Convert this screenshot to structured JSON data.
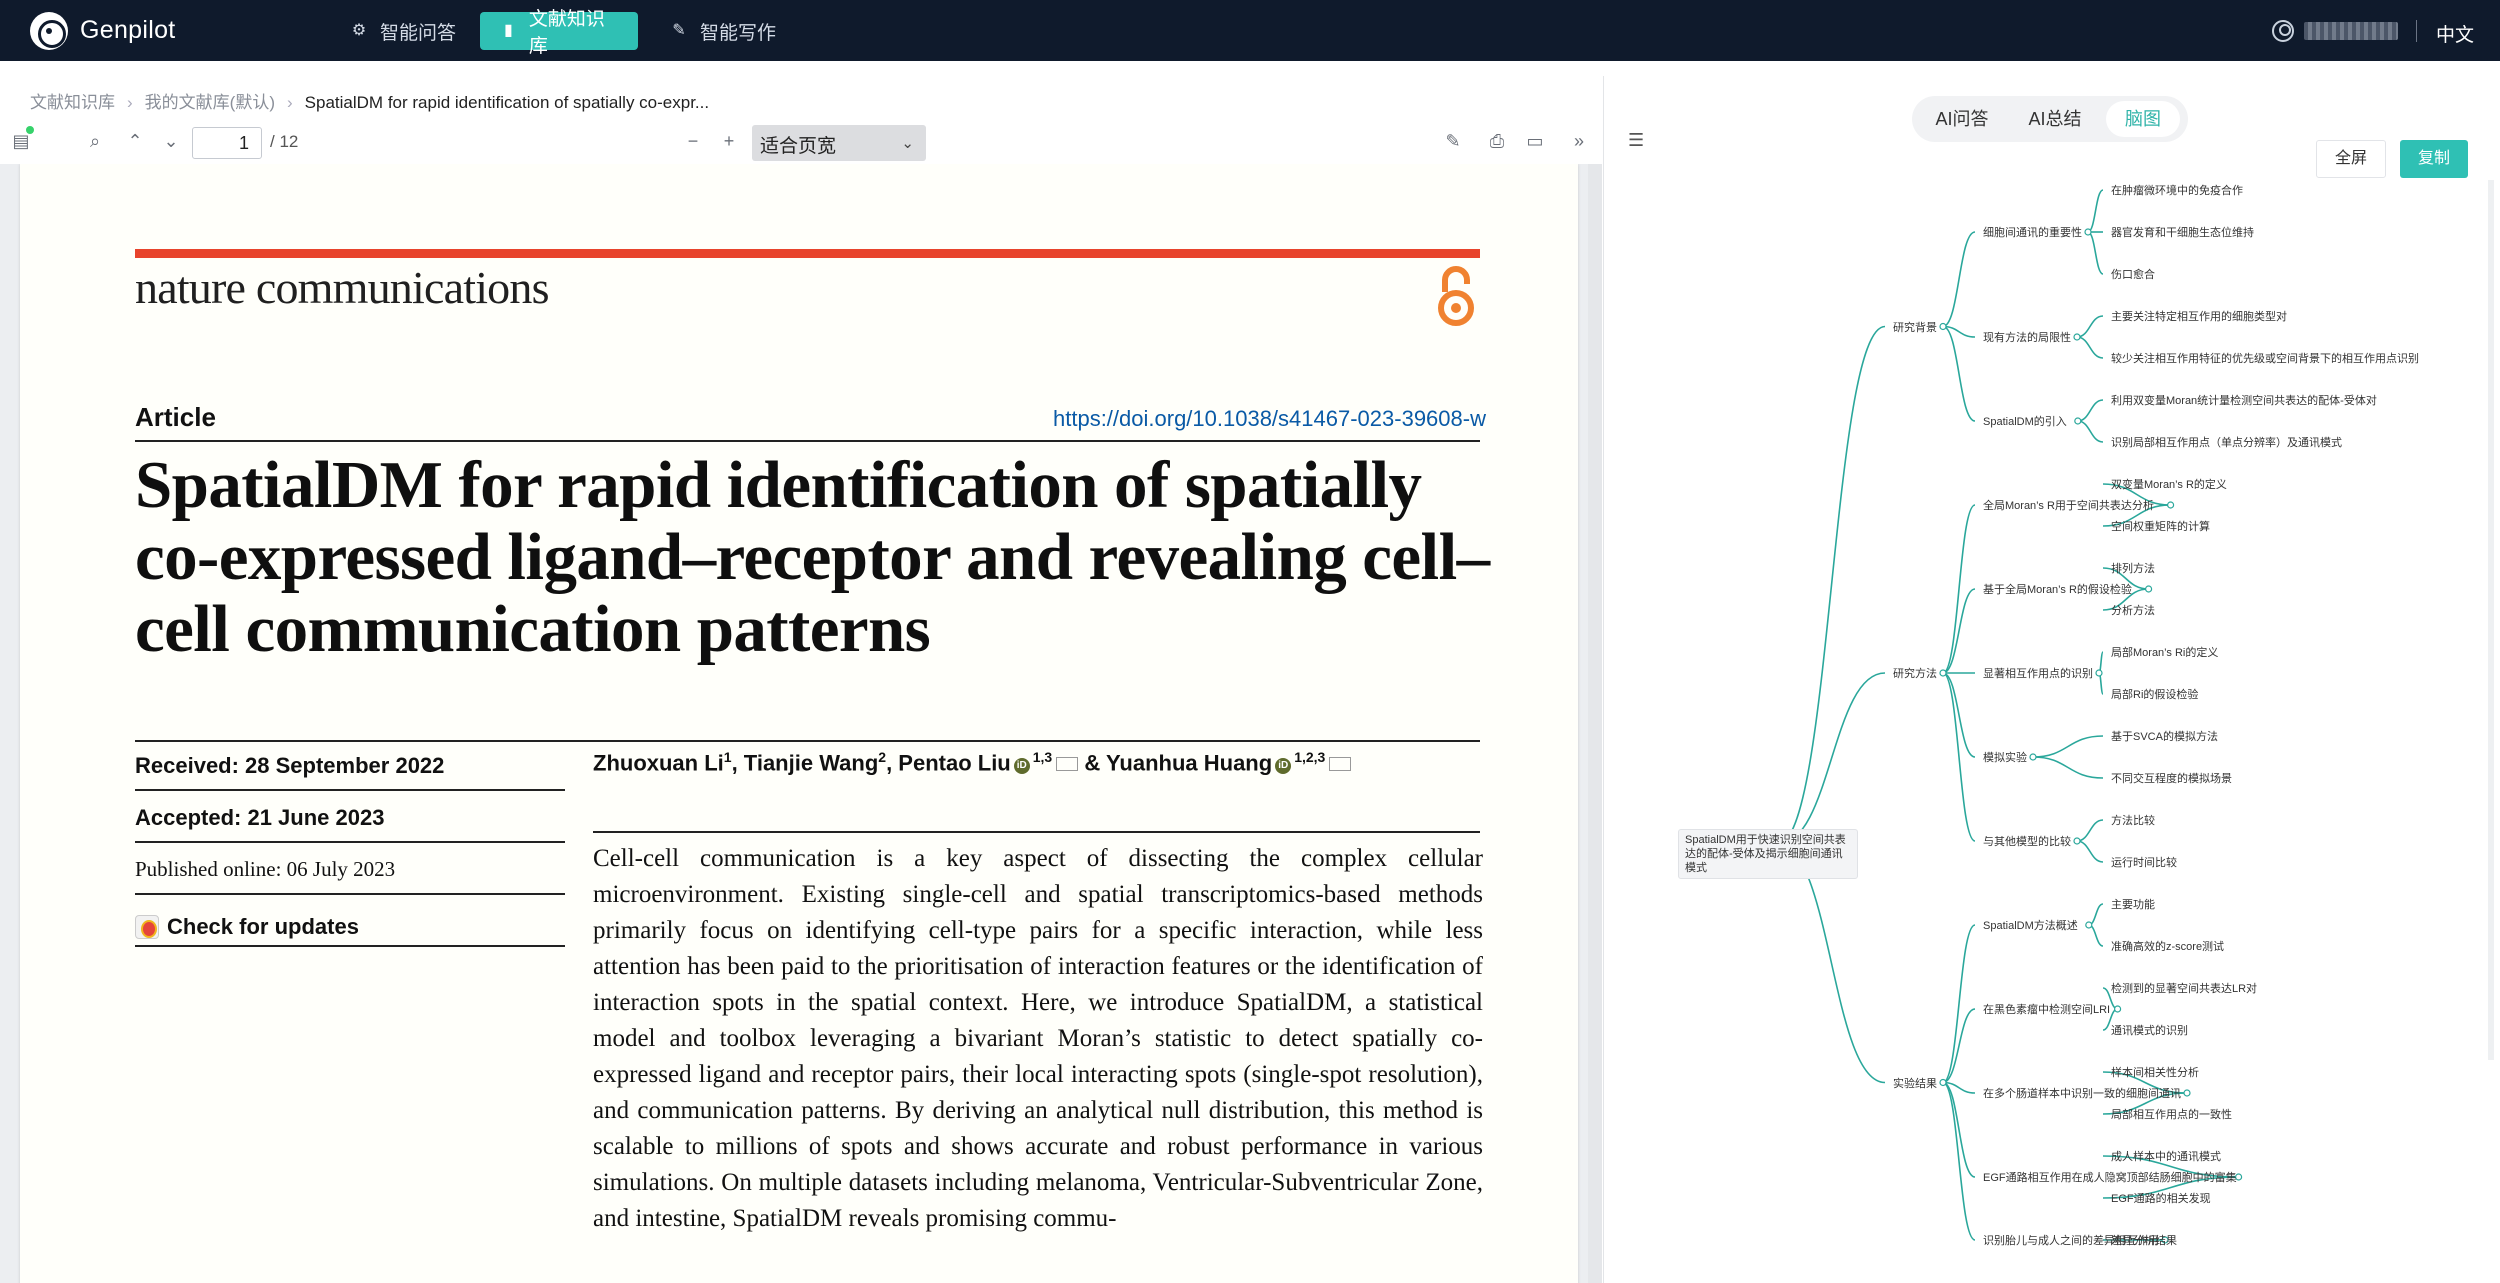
{
  "app": {
    "brand": "Genpilot",
    "nav_tabs": [
      {
        "label": "智能问答",
        "icon": "gear-icon"
      },
      {
        "label": "文献知识库",
        "icon": "book-icon"
      },
      {
        "label": "智能写作",
        "icon": "edit-icon"
      }
    ],
    "active_tab": "文献知识库",
    "language": "中文"
  },
  "breadcrumb": [
    "文献知识库",
    "我的文献库(默认)",
    "SpatialDM for rapid identification of spatially co-expr..."
  ],
  "pdf_toolbar": {
    "page_current": "1",
    "page_total": "/ 12",
    "zoom_label": "适合页宽"
  },
  "pdf": {
    "journal": "nature communications",
    "article_label": "Article",
    "doi": "https://doi.org/10.1038/s41467-023-39608-w",
    "title": "SpatialDM for rapid identification of spatially co-expressed ligand–receptor and revealing cell–cell communication patterns",
    "received": "Received: 28 September 2022",
    "accepted": "Accepted: 21 June 2023",
    "published": "Published online: 06 July 2023",
    "check_updates": "Check for updates",
    "authors": {
      "a1": "Zhuoxuan Li",
      "a1_sup": "1",
      "a2": "Tianjie Wang",
      "a2_sup": "2",
      "a3": "Pentao Liu",
      "a3_sup": "1,3",
      "amp": "&",
      "a4": "Yuanhua Huang",
      "a4_sup": "1,2,3"
    },
    "abstract": "Cell-cell communication is a key aspect of dissecting the complex cellular microenvironment. Existing single-cell and spatial transcriptomics-based methods primarily focus on identifying cell-type pairs for a specific interaction, while less attention has been paid to the prioritisation of interaction features or the identification of interaction spots in the spatial context. Here, we introduce SpatialDM, a statistical model and toolbox leveraging a bivariant Moran’s statistic to detect spatially co-expressed ligand and receptor pairs, their local interacting spots (single-spot resolution), and communication patterns. By deriving an analytical null distribution, this method is scalable to millions of spots and shows accurate and robust performance in various simulations. On multiple datasets including melanoma, Ventricular-Subventricular Zone, and intestine, SpatialDM reveals promising commu-"
  },
  "right_panel": {
    "tabs": [
      "AI问答",
      "AI总结",
      "脑图"
    ],
    "active_tab": "脑图",
    "fullscreen_label": "全屏",
    "copy_label": "复制"
  },
  "mindmap": {
    "root": "SpatialDM用于快速识别空间共表达的配体-受体及揭示细胞间通讯模式",
    "branches": [
      {
        "label": "研究背景",
        "children": [
          {
            "label": "细胞间通讯的重要性",
            "children": [
              "在肿瘤微环境中的免疫合作",
              "器官发育和干细胞生态位维持",
              "伤口愈合"
            ]
          },
          {
            "label": "现有方法的局限性",
            "children": [
              "主要关注特定相互作用的细胞类型对",
              "较少关注相互作用特征的优先级或空间背景下的相互作用点识别"
            ]
          },
          {
            "label": "SpatialDM的引入",
            "children": [
              "利用双变量Moran统计量检测空间共表达的配体-受体对",
              "识别局部相互作用点（单点分辨率）及通讯模式"
            ]
          }
        ]
      },
      {
        "label": "研究方法",
        "children": [
          {
            "label": "全局Moran’s R用于空间共表达分析",
            "children": [
              "双变量Moran’s R的定义",
              "空间权重矩阵的计算"
            ]
          },
          {
            "label": "基于全局Moran’s R的假设检验",
            "children": [
              "排列方法",
              "分析方法"
            ]
          },
          {
            "label": "显著相互作用点的识别",
            "children": [
              "局部Moran’s Ri的定义",
              "局部Ri的假设检验"
            ]
          },
          {
            "label": "模拟实验",
            "children": [
              "基于SVCA的模拟方法",
              "不同交互程度的模拟场景"
            ]
          },
          {
            "label": "与其他模型的比较",
            "children": [
              "方法比较",
              "运行时间比较"
            ]
          }
        ]
      },
      {
        "label": "实验结果",
        "children": [
          {
            "label": "SpatialDM方法概述",
            "children": [
              "主要功能",
              "准确高效的z-score测试"
            ]
          },
          {
            "label": "在黑色素瘤中检测空间LRI",
            "children": [
              "检测到的显著空间共表达LR对",
              "通讯模式的识别"
            ]
          },
          {
            "label": "在多个肠道样本中识别一致的细胞间通讯",
            "children": [
              "样本间相关性分析",
              "局部相互作用点的一致性"
            ]
          },
          {
            "label": "EGF通路相互作用在成人隐窝顶部结肠细胞中的富集",
            "children": [
              "成人样本中的通讯模式",
              "EGF通路的相关发现"
            ]
          },
          {
            "label": "识别胎儿与成人之间的差异相互作用",
            "children": [
              "差异分析结果"
            ]
          }
        ]
      }
    ]
  }
}
